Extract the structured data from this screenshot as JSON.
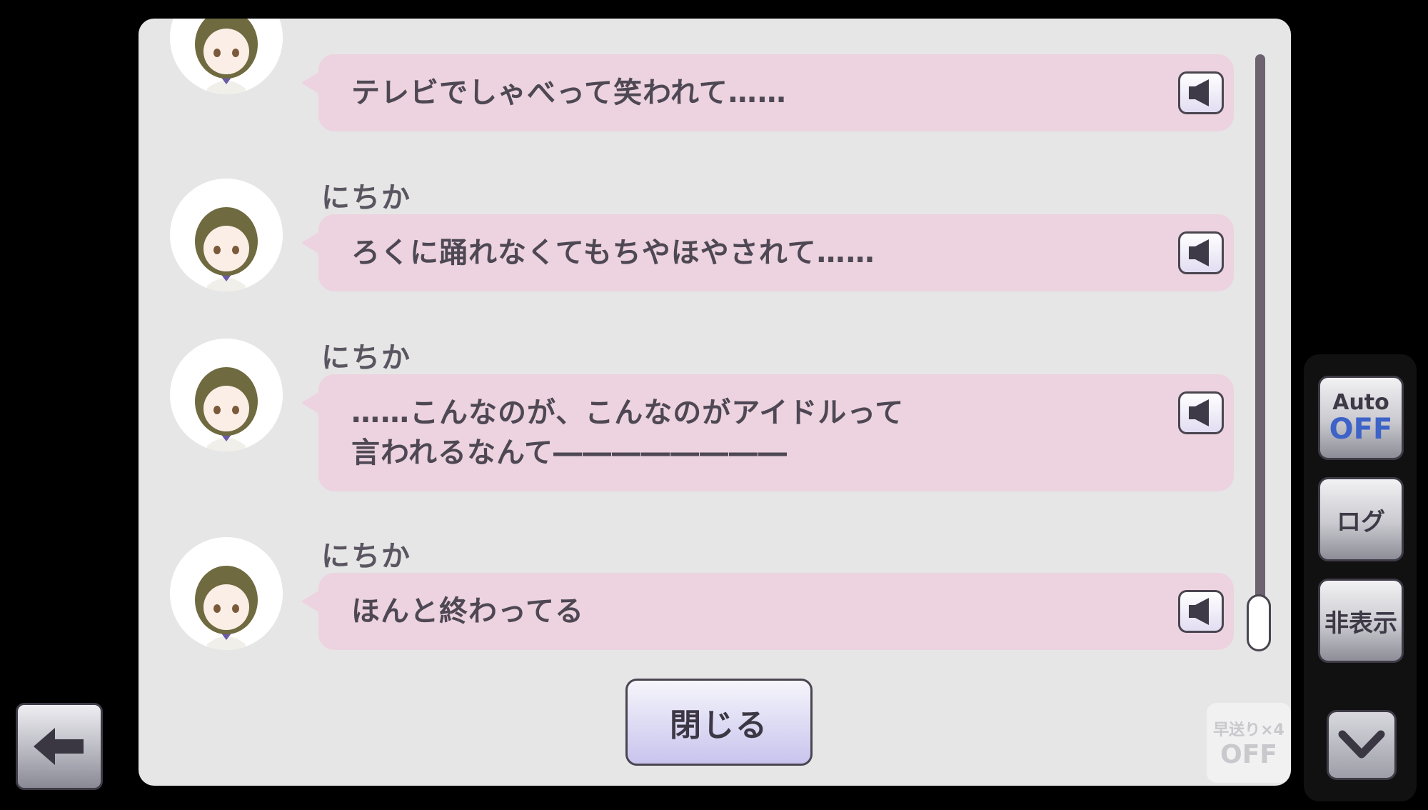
{
  "log": {
    "entries": [
      {
        "speaker": "",
        "text": "テレビでしゃべって笑われて……"
      },
      {
        "speaker": "にちか",
        "text": "ろくに踊れなくてもちやほやされて……"
      },
      {
        "speaker": "にちか",
        "text": "……こんなのが、こんなのがアイドルって\n言われるなんて――――――――"
      },
      {
        "speaker": "にちか",
        "text": "ほんと終わってる"
      }
    ],
    "close_label": "閉じる",
    "fast_forward": {
      "line1": "早送り×4",
      "line2": "OFF"
    }
  },
  "controls": {
    "auto_label": "Auto",
    "auto_state": "OFF",
    "log_label": "ログ",
    "hide_label": "非表示"
  },
  "colors": {
    "bubble": "#ecd3df",
    "panel": "#e6e6e6",
    "auto_state": "#3d62c8"
  }
}
